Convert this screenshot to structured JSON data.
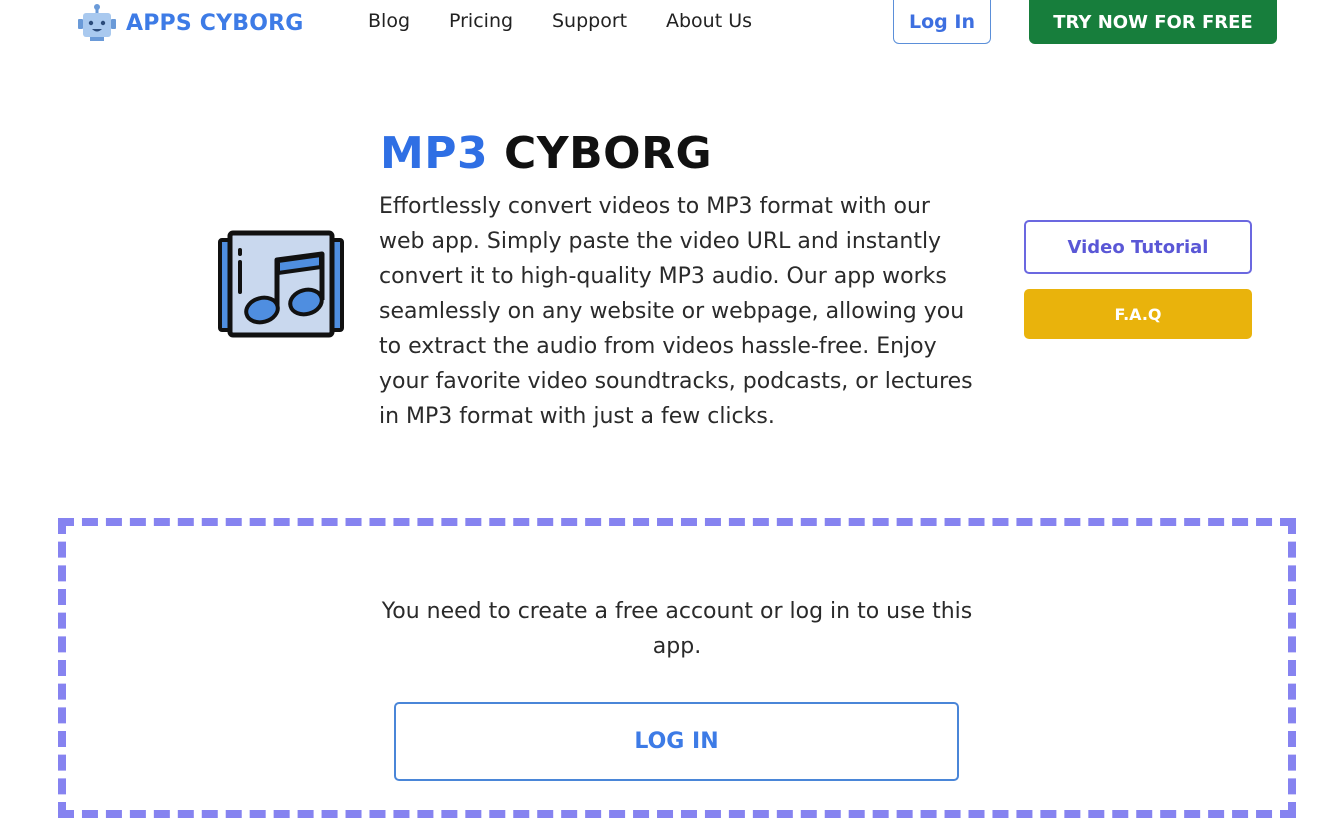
{
  "header": {
    "logo_text": "APPS CYBORG",
    "logo_icon": "robot-icon",
    "nav": [
      {
        "label": "Blog"
      },
      {
        "label": "Pricing"
      },
      {
        "label": "Support"
      },
      {
        "label": "About Us"
      }
    ],
    "login_label": "Log In",
    "try_label": "TRY NOW FOR FREE"
  },
  "hero": {
    "title_part1": "MP3",
    "title_part2": "CYBORG",
    "icon": "music-album-icon",
    "description": "Effortlessly convert videos to MP3 format with our web app. Simply paste the video URL and instantly convert it to high-quality MP3 audio. Our app works seamlessly on any website or webpage, allowing you to extract the audio from videos hassle-free. Enjoy your favorite video soundtracks, podcasts, or lectures in MP3 format with just a few clicks.",
    "video_tutorial_label": "Video Tutorial",
    "faq_label": "F.A.Q"
  },
  "login_box": {
    "message": "You need to create a free account or log in to use this app.",
    "login_button_label": "LOG IN"
  },
  "colors": {
    "brand_blue": "#3d7be6",
    "try_green": "#177e3c",
    "faq_yellow": "#e9b30c",
    "video_purple": "#6b68e0",
    "dashed_border": "#8683f0"
  }
}
